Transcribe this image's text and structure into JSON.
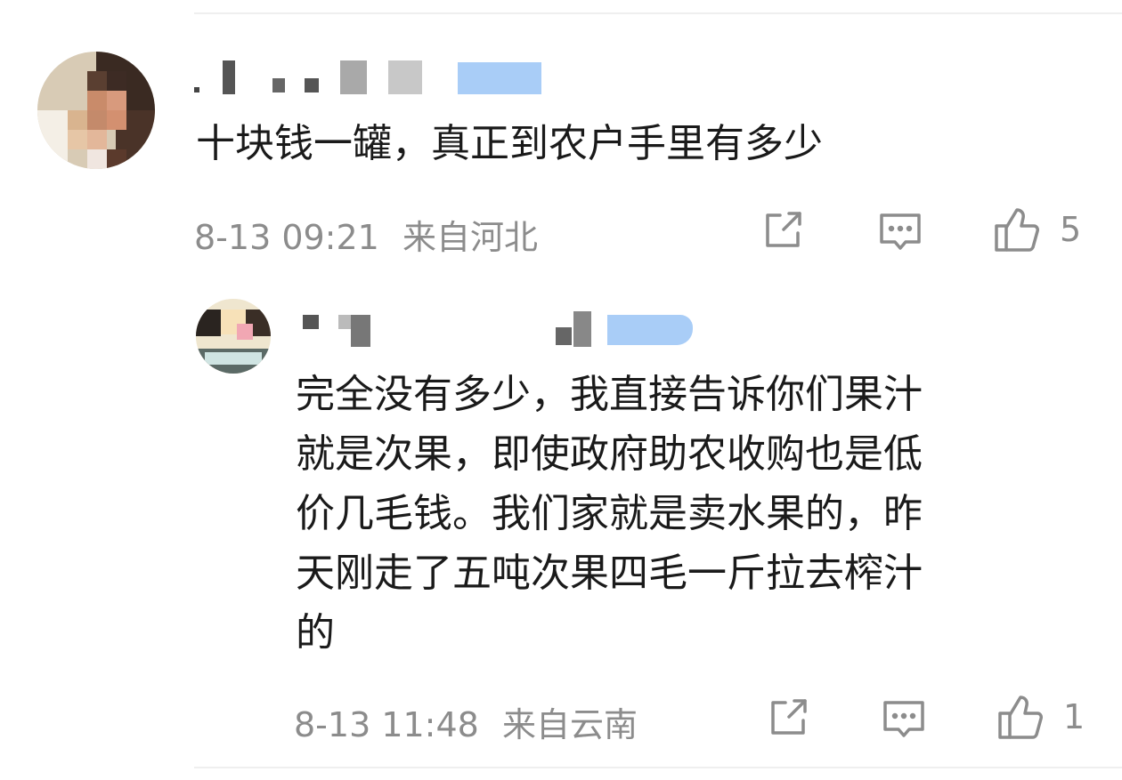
{
  "comments": [
    {
      "text": "十块钱一罐，真正到农户手里有多少",
      "timestamp": "8-13 09:21",
      "location": "来自河北",
      "likes": "5",
      "icons": [
        "share-icon",
        "comment-icon",
        "thumbs-up-icon"
      ]
    },
    {
      "text": "完全没有多少，我直接告诉你们果汁就是次果，即使政府助农收购也是低价几毛钱。我们家就是卖水果的，昨天刚走了五吨次果四毛一斤拉去榨汁的",
      "lines": [
        "完全没有多少，我直接告诉你们果汁",
        "就是次果，即使政府助农收购也是低",
        "价几毛钱。我们家就是卖水果的，昨",
        "天刚走了五吨次果四毛一斤拉去榨汁",
        "的"
      ],
      "timestamp": "8-13 11:48",
      "location": "来自云南",
      "likes": "1",
      "icons": [
        "share-icon",
        "comment-icon",
        "thumbs-up-icon"
      ]
    }
  ],
  "colors": {
    "text": "#1a1a1a",
    "meta": "#8c8c8c",
    "divider": "#efefef"
  }
}
